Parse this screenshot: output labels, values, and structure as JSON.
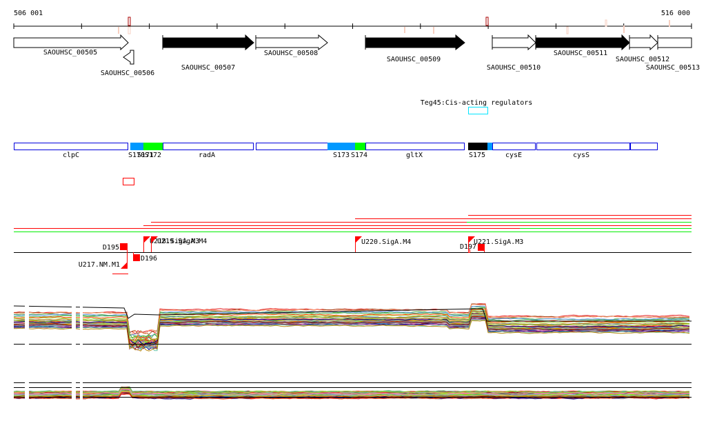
{
  "ruler": {
    "start_label": "506 001",
    "end_label": "516 000"
  },
  "genes": [
    {
      "id": "SAOUHSC_00505",
      "strand": "+",
      "style": "open"
    },
    {
      "id": "SAOUHSC_00506",
      "strand": "-",
      "style": "open"
    },
    {
      "id": "SAOUHSC_00507",
      "strand": "+",
      "style": "filled"
    },
    {
      "id": "SAOUHSC_00508",
      "strand": "+",
      "style": "open"
    },
    {
      "id": "SAOUHSC_00509",
      "strand": "+",
      "style": "filled"
    },
    {
      "id": "SAOUHSC_00510",
      "strand": "+",
      "style": "open"
    },
    {
      "id": "SAOUHSC_00511",
      "strand": "+",
      "style": "filled"
    },
    {
      "id": "SAOUHSC_00512",
      "strand": "+",
      "style": "open"
    },
    {
      "id": "SAOUHSC_00513",
      "strand": "+",
      "style": "open"
    }
  ],
  "regulator": {
    "label": "Teg45:Cis-acting regulators",
    "color": "#00e5ff"
  },
  "segments": {
    "labels": [
      "clpC",
      "S170",
      "S171",
      "S172",
      "radA",
      "S173",
      "S174",
      "gltX",
      "S175",
      "cysE",
      "cysS"
    ],
    "colors": {
      "gene_border": "#0000dd",
      "blue": "#0099ff",
      "green": "#00ff00",
      "black": "#000000"
    }
  },
  "tss": {
    "labels": [
      "D195",
      "U217.NM.M1",
      "D196",
      "U218.SigA.M3",
      "U219.SigA.M4",
      "U220.SigA.M4",
      "D197",
      "U221.SigA.M3"
    ],
    "color": "#ff0000"
  },
  "colors": {
    "red": "#ff0000",
    "green": "#00ee00",
    "dark_red": "#aa0000",
    "pale": "#f7cfc0"
  }
}
